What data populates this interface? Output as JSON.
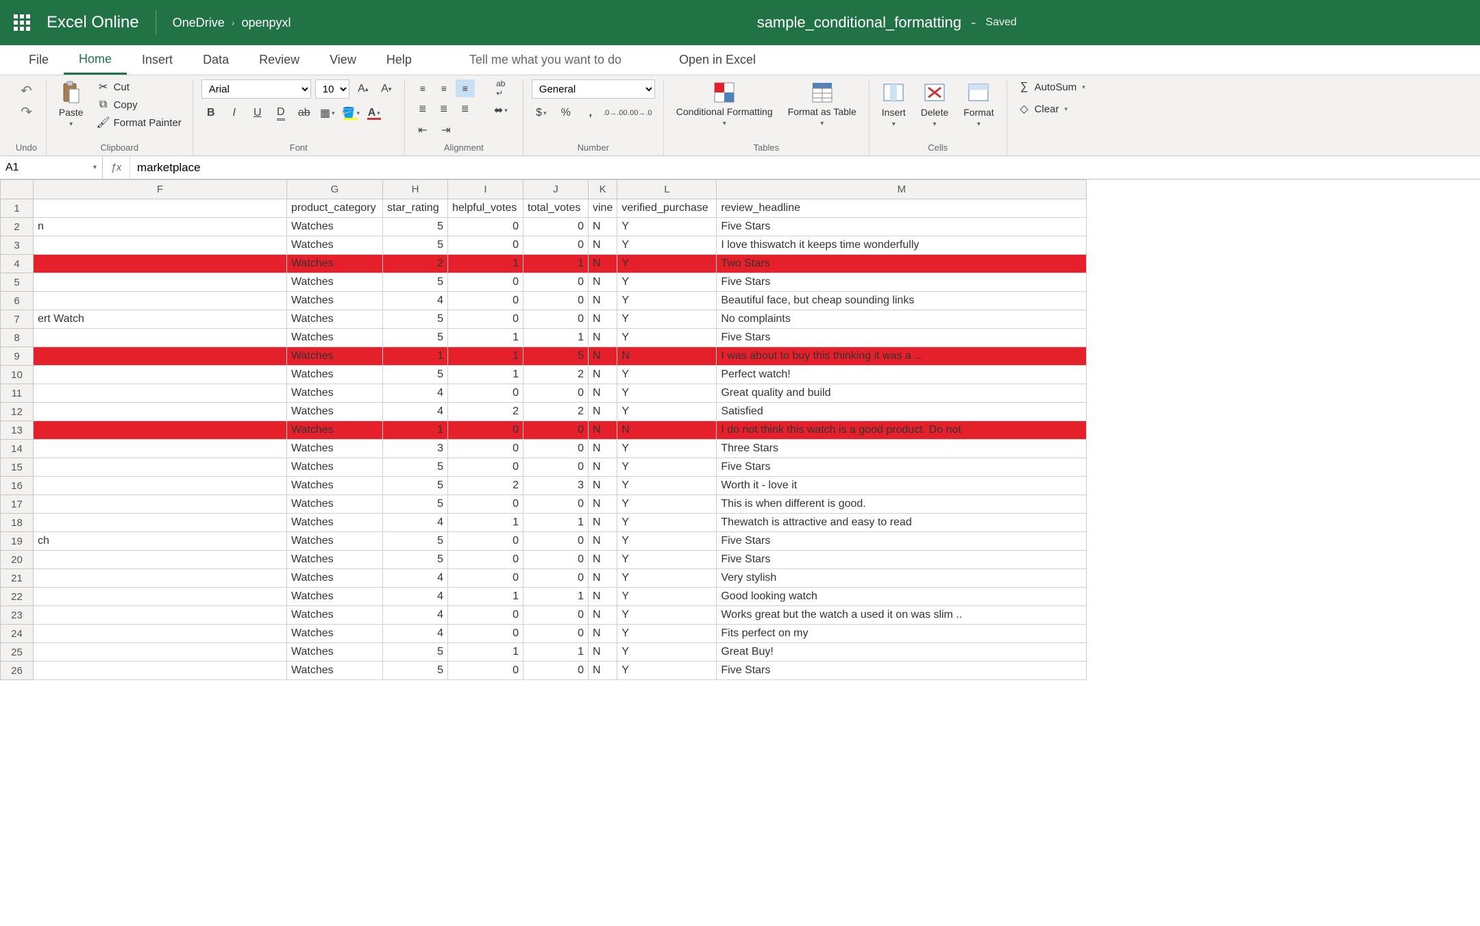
{
  "titlebar": {
    "app_name": "Excel Online",
    "breadcrumb_root": "OneDrive",
    "breadcrumb_leaf": "openpyxl",
    "doc_name": "sample_conditional_formatting",
    "status": "Saved"
  },
  "tabs": {
    "file": "File",
    "home": "Home",
    "insert": "Insert",
    "data": "Data",
    "review": "Review",
    "view": "View",
    "help": "Help",
    "tell_me": "Tell me what you want to do",
    "open_excel": "Open in Excel"
  },
  "ribbon": {
    "undo_label": "Undo",
    "paste": "Paste",
    "cut": "Cut",
    "copy": "Copy",
    "format_painter": "Format Painter",
    "clipboard_label": "Clipboard",
    "font_name": "Arial",
    "font_size": "10",
    "font_label": "Font",
    "alignment_label": "Alignment",
    "number_format": "General",
    "number_label": "Number",
    "cond_fmt": "Conditional Formatting",
    "fmt_table": "Format as Table",
    "tables_label": "Tables",
    "insert_btn": "Insert",
    "delete_btn": "Delete",
    "format_btn": "Format",
    "cells_label": "Cells",
    "autosum": "AutoSum",
    "clear": "Clear"
  },
  "formula": {
    "namebox": "A1",
    "value": "marketplace"
  },
  "columns": [
    "F",
    "G",
    "H",
    "I",
    "J",
    "K",
    "L",
    "M"
  ],
  "col_widths": {
    "F": "c-F",
    "G": "c-G",
    "H": "c-H",
    "I": "c-I",
    "J": "c-J",
    "K": "c-K",
    "L": "c-L",
    "M": "c-M"
  },
  "headers": {
    "G": "product_category",
    "H": "star_rating",
    "I": "helpful_votes",
    "J": "total_votes",
    "K": "vine",
    "L": "verified_purchase",
    "M": "review_headline"
  },
  "rows": [
    {
      "r": 1,
      "hl": false,
      "F": "",
      "G": "product_category",
      "H": "star_rating",
      "I": "helpful_votes",
      "J": "total_votes",
      "K": "vine",
      "L": "verified_purchase",
      "M": "review_headline",
      "is_header": true
    },
    {
      "r": 2,
      "hl": false,
      "F": "n",
      "G": "Watches",
      "H": 5,
      "I": 0,
      "J": 0,
      "K": "N",
      "L": "Y",
      "M": "Five Stars"
    },
    {
      "r": 3,
      "hl": false,
      "F": "",
      "G": "Watches",
      "H": 5,
      "I": 0,
      "J": 0,
      "K": "N",
      "L": "Y",
      "M": "I love thiswatch it keeps time wonderfully"
    },
    {
      "r": 4,
      "hl": true,
      "F": "",
      "G": "Watches",
      "H": 2,
      "I": 1,
      "J": 1,
      "K": "N",
      "L": "Y",
      "M": "Two Stars"
    },
    {
      "r": 5,
      "hl": false,
      "F": "",
      "G": "Watches",
      "H": 5,
      "I": 0,
      "J": 0,
      "K": "N",
      "L": "Y",
      "M": "Five Stars"
    },
    {
      "r": 6,
      "hl": false,
      "F": "",
      "G": "Watches",
      "H": 4,
      "I": 0,
      "J": 0,
      "K": "N",
      "L": "Y",
      "M": "Beautiful face, but cheap sounding links"
    },
    {
      "r": 7,
      "hl": false,
      "F": "ert Watch",
      "G": "Watches",
      "H": 5,
      "I": 0,
      "J": 0,
      "K": "N",
      "L": "Y",
      "M": "No complaints"
    },
    {
      "r": 8,
      "hl": false,
      "F": "",
      "G": "Watches",
      "H": 5,
      "I": 1,
      "J": 1,
      "K": "N",
      "L": "Y",
      "M": "Five Stars"
    },
    {
      "r": 9,
      "hl": true,
      "F": "",
      "G": "Watches",
      "H": 1,
      "I": 1,
      "J": 5,
      "K": "N",
      "L": "N",
      "M": "I was about to buy this thinking it was a ..."
    },
    {
      "r": 10,
      "hl": false,
      "F": "",
      "G": "Watches",
      "H": 5,
      "I": 1,
      "J": 2,
      "K": "N",
      "L": "Y",
      "M": "Perfect watch!"
    },
    {
      "r": 11,
      "hl": false,
      "F": "",
      "G": "Watches",
      "H": 4,
      "I": 0,
      "J": 0,
      "K": "N",
      "L": "Y",
      "M": "Great quality and build"
    },
    {
      "r": 12,
      "hl": false,
      "F": "",
      "G": "Watches",
      "H": 4,
      "I": 2,
      "J": 2,
      "K": "N",
      "L": "Y",
      "M": "Satisfied"
    },
    {
      "r": 13,
      "hl": true,
      "F": "",
      "G": "Watches",
      "H": 1,
      "I": 0,
      "J": 0,
      "K": "N",
      "L": "N",
      "M": "I do not think this watch is a good product. Do not"
    },
    {
      "r": 14,
      "hl": false,
      "F": "",
      "G": "Watches",
      "H": 3,
      "I": 0,
      "J": 0,
      "K": "N",
      "L": "Y",
      "M": "Three Stars"
    },
    {
      "r": 15,
      "hl": false,
      "F": "",
      "G": "Watches",
      "H": 5,
      "I": 0,
      "J": 0,
      "K": "N",
      "L": "Y",
      "M": "Five Stars"
    },
    {
      "r": 16,
      "hl": false,
      "F": "",
      "G": "Watches",
      "H": 5,
      "I": 2,
      "J": 3,
      "K": "N",
      "L": "Y",
      "M": "Worth it - love it"
    },
    {
      "r": 17,
      "hl": false,
      "F": "",
      "G": "Watches",
      "H": 5,
      "I": 0,
      "J": 0,
      "K": "N",
      "L": "Y",
      "M": "This is when different is good."
    },
    {
      "r": 18,
      "hl": false,
      "F": "",
      "G": "Watches",
      "H": 4,
      "I": 1,
      "J": 1,
      "K": "N",
      "L": "Y",
      "M": "Thewatch is attractive and easy to read"
    },
    {
      "r": 19,
      "hl": false,
      "F": "ch",
      "G": "Watches",
      "H": 5,
      "I": 0,
      "J": 0,
      "K": "N",
      "L": "Y",
      "M": "Five Stars"
    },
    {
      "r": 20,
      "hl": false,
      "F": "",
      "G": "Watches",
      "H": 5,
      "I": 0,
      "J": 0,
      "K": "N",
      "L": "Y",
      "M": "Five Stars"
    },
    {
      "r": 21,
      "hl": false,
      "F": "",
      "G": "Watches",
      "H": 4,
      "I": 0,
      "J": 0,
      "K": "N",
      "L": "Y",
      "M": "Very stylish"
    },
    {
      "r": 22,
      "hl": false,
      "F": "",
      "G": "Watches",
      "H": 4,
      "I": 1,
      "J": 1,
      "K": "N",
      "L": "Y",
      "M": "Good looking watch"
    },
    {
      "r": 23,
      "hl": false,
      "F": "",
      "G": "Watches",
      "H": 4,
      "I": 0,
      "J": 0,
      "K": "N",
      "L": "Y",
      "M": "Works great but the watch a used it on was slim .."
    },
    {
      "r": 24,
      "hl": false,
      "F": "",
      "G": "Watches",
      "H": 4,
      "I": 0,
      "J": 0,
      "K": "N",
      "L": "Y",
      "M": "Fits perfect on my"
    },
    {
      "r": 25,
      "hl": false,
      "F": "",
      "G": "Watches",
      "H": 5,
      "I": 1,
      "J": 1,
      "K": "N",
      "L": "Y",
      "M": "Great Buy!"
    },
    {
      "r": 26,
      "hl": false,
      "F": "",
      "G": "Watches",
      "H": 5,
      "I": 0,
      "J": 0,
      "K": "N",
      "L": "Y",
      "M": "Five Stars"
    }
  ],
  "icons": {}
}
